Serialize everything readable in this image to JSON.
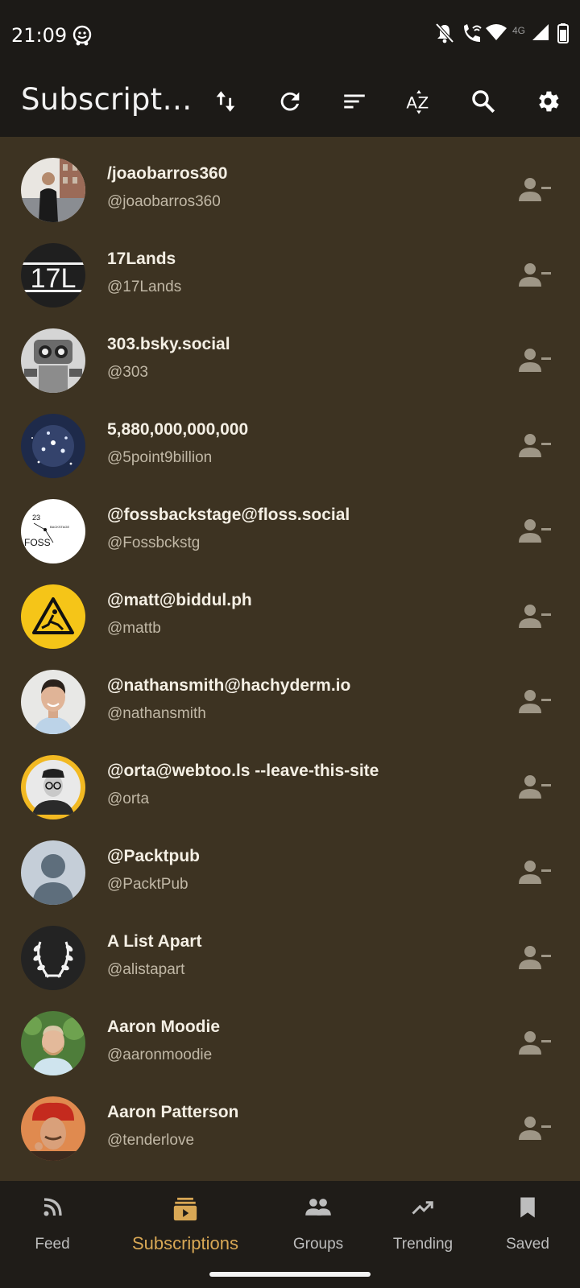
{
  "status_bar": {
    "time": "21:09",
    "network": "4G",
    "icons": [
      "waze-icon",
      "bell-off-icon",
      "wifi-call-icon",
      "wifi-icon",
      "signal-icon",
      "battery-icon"
    ]
  },
  "app_bar": {
    "title": "Subscript…",
    "actions": [
      "sort-direction-icon",
      "refresh-icon",
      "filter-icon",
      "sort-az-icon",
      "search-icon",
      "settings-icon"
    ]
  },
  "subscriptions": [
    {
      "name": "/joaobarros360",
      "handle": "@joaobarros360"
    },
    {
      "name": "17Lands",
      "handle": "@17Lands"
    },
    {
      "name": "303.bsky.social",
      "handle": "@303"
    },
    {
      "name": "5,880,000,000,000",
      "handle": "@5point9billion"
    },
    {
      "name": "@fossbackstage@floss.social",
      "handle": "@Fossbckstg"
    },
    {
      "name": "@matt@biddul.ph",
      "handle": "@mattb"
    },
    {
      "name": "@nathansmith@hachyderm.io",
      "handle": "@nathansmith"
    },
    {
      "name": "@orta@webtoo.ls --leave-this-site",
      "handle": "@orta"
    },
    {
      "name": "@Packtpub",
      "handle": "@PacktPub"
    },
    {
      "name": "A List Apart",
      "handle": "@alistapart"
    },
    {
      "name": "Aaron Moodie",
      "handle": "@aaronmoodie"
    },
    {
      "name": "Aaron Patterson",
      "handle": "@tenderlove"
    }
  ],
  "avatar_text": {
    "lands": "17L",
    "foss_num": "23",
    "foss_label": "FOSS",
    "foss_small": "BACKSTAGE"
  },
  "bottom_nav": {
    "active": "Subscriptions",
    "items": [
      "Feed",
      "Subscriptions",
      "Groups",
      "Trending",
      "Saved"
    ]
  },
  "colors": {
    "background": "#3d3322",
    "bar": "#1c1a17",
    "accent": "#d9a855",
    "text_primary": "#f4efe4",
    "text_secondary": "#c1b8a6"
  }
}
